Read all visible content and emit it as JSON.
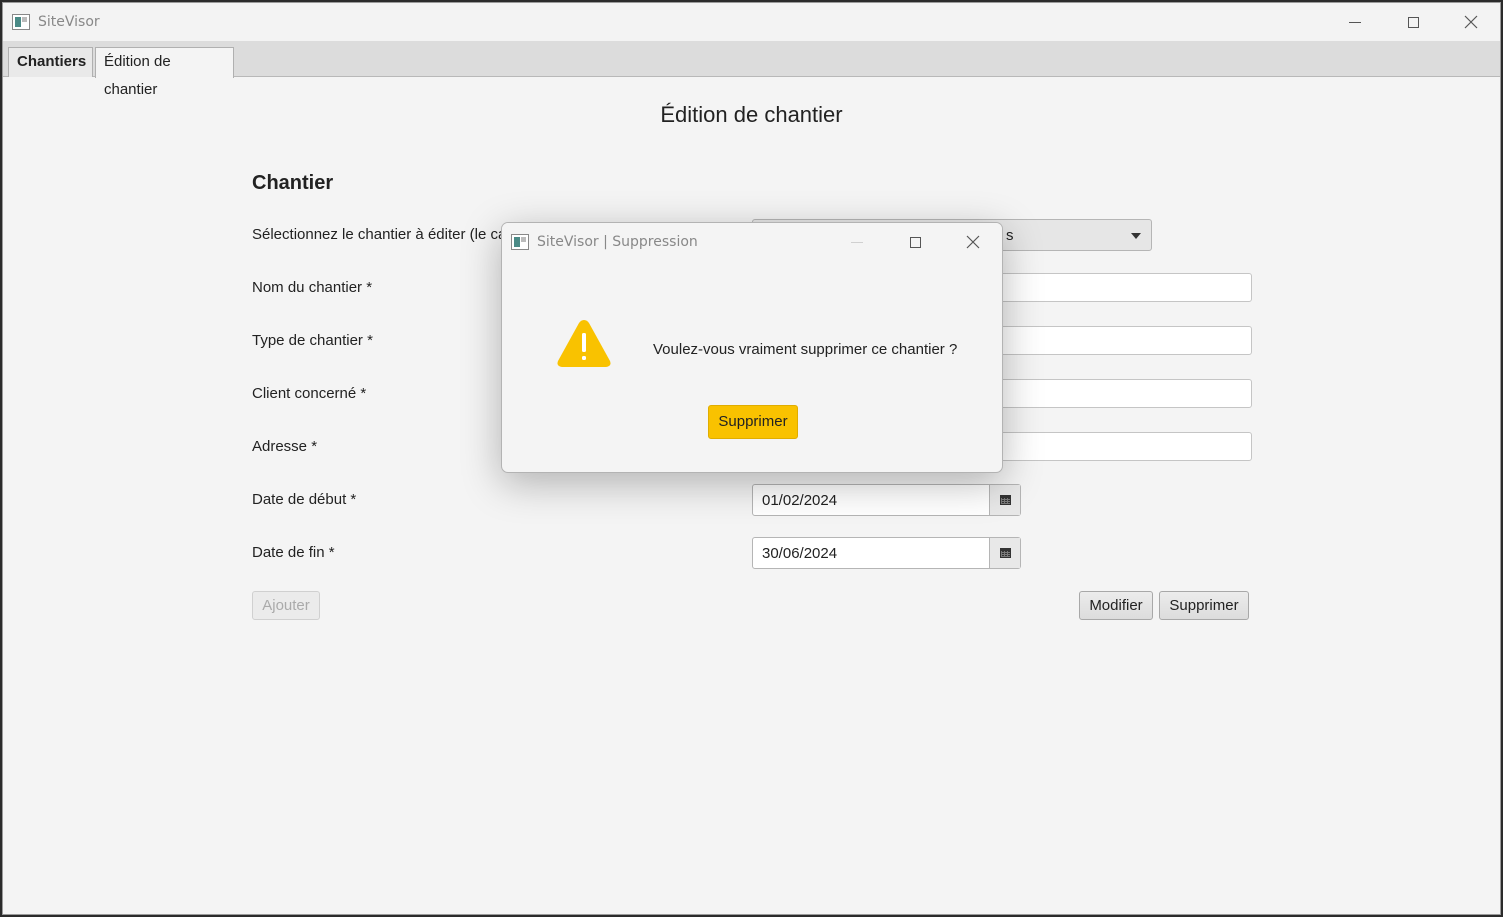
{
  "window": {
    "title": "SiteVisor"
  },
  "tabs": [
    {
      "label": "Chantiers"
    },
    {
      "label": "Édition de chantier"
    }
  ],
  "page": {
    "title": "Édition de chantier",
    "section": "Chantier"
  },
  "form": {
    "select_label": "Sélectionnez le chantier à éditer (le ca",
    "select_value_visible": "s",
    "name_label": "Nom du chantier *",
    "type_label": "Type de chantier *",
    "client_label": "Client concerné *",
    "address_label": "Adresse *",
    "start_label": "Date de début *",
    "start_value": "01/02/2024",
    "end_label": "Date de fin *",
    "end_value": "30/06/2024"
  },
  "buttons": {
    "add": "Ajouter",
    "modify": "Modifier",
    "delete": "Supprimer"
  },
  "dialog": {
    "title": "SiteVisor | Suppression",
    "message": "Voulez-vous vraiment supprimer ce chantier ?",
    "confirm": "Supprimer",
    "icon": "warning-icon",
    "accent_color": "#f9c200"
  }
}
